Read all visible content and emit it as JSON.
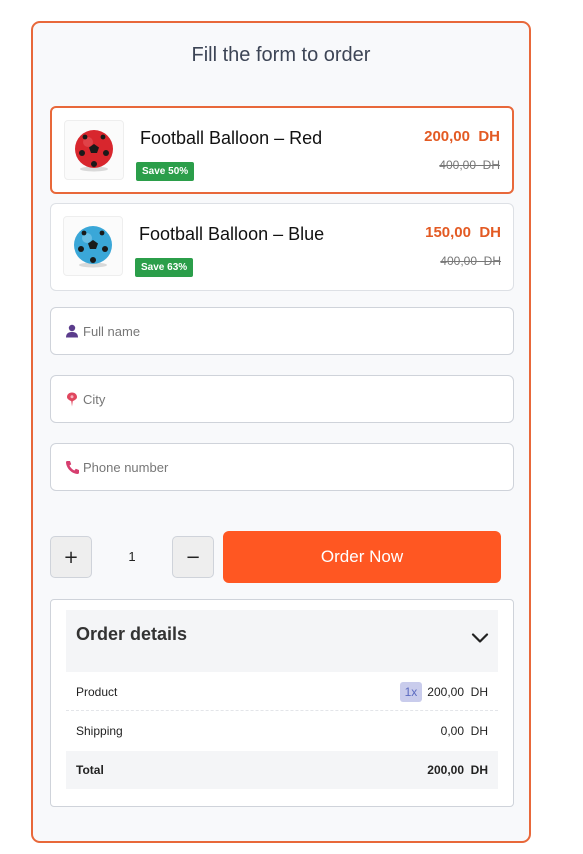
{
  "form": {
    "title": "Fill the form to order",
    "products": [
      {
        "name": "Football Balloon – Red",
        "badge": "Save 50%",
        "price": "200,00  DH",
        "old_price": "400,00  DH",
        "selected": true,
        "image": "red-football-image",
        "ball_color": "#d8262d"
      },
      {
        "name": "Football Balloon – Blue",
        "badge": "Save 63%",
        "price": "150,00  DH",
        "old_price": "400,00  DH",
        "selected": false,
        "image": "blue-football-image",
        "ball_color": "#3aa7d8"
      }
    ],
    "fields": {
      "full_name": {
        "placeholder": "Full name",
        "value": "",
        "icon": "user-icon"
      },
      "city": {
        "placeholder": "City",
        "value": "",
        "icon": "location-pin-icon"
      },
      "phone": {
        "placeholder": "Phone number",
        "value": "",
        "icon": "phone-icon"
      }
    },
    "quantity": {
      "plus_label": "+",
      "minus_label": "−",
      "value": "1"
    },
    "order_button_label": "Order Now",
    "order_details": {
      "title": "Order details",
      "rows": [
        {
          "label": "Product",
          "qty": "1x",
          "value": "200,00  DH"
        },
        {
          "label": "Shipping",
          "value": "0,00  DH"
        },
        {
          "label": "Total",
          "value": "200,00  DH"
        }
      ]
    }
  },
  "colors": {
    "accent": "#e8683a",
    "button": "#ff5722",
    "price": "#e35a23",
    "badge": "#2b9e4a"
  }
}
